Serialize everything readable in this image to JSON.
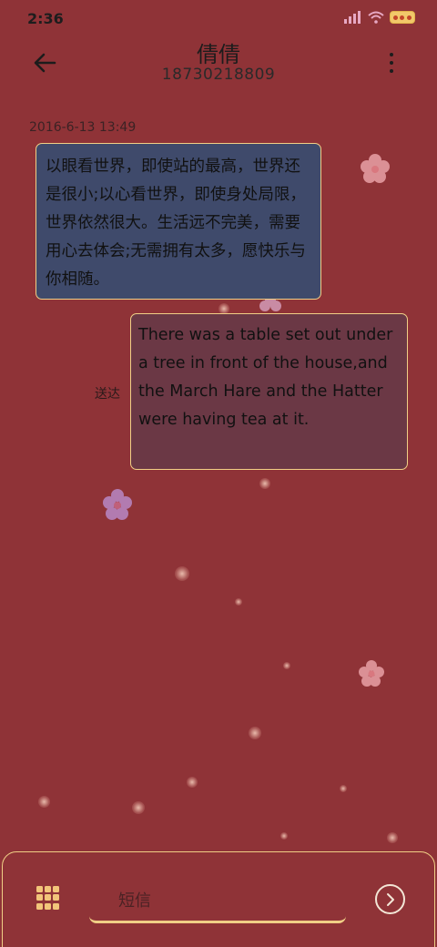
{
  "status_bar": {
    "time": "2:36",
    "icons": [
      "signal-icon",
      "wifi-icon",
      "battery-icon"
    ]
  },
  "header": {
    "back_icon": "arrow-left-icon",
    "contact_name": "倩倩",
    "phone_number": "18730218809",
    "more_icon": "more-vertical-icon"
  },
  "conversation": {
    "timestamp": "2016-6-13 13:49",
    "messages": [
      {
        "direction": "incoming",
        "text": "以眼看世界，即使站的最高，世界还是很小;以心看世界，即使身处局限，世界依然很大。生活远不完美，需要用心去体会;无需拥有太多，愿快乐与你相随。"
      },
      {
        "direction": "outgoing",
        "text": "There was a table set out under a tree in front of the house,and the March Hare and the Hatter were having tea at it.",
        "status": "送达"
      }
    ]
  },
  "composer": {
    "apps_icon": "grid-icon",
    "placeholder": "短信",
    "value": "",
    "send_icon": "send-chevron-icon"
  },
  "colors": {
    "background": "#8f3337",
    "incoming_bubble": "#3f4a6b",
    "outgoing_bubble": "#6b3845",
    "accent_border": "#f0cf86"
  }
}
